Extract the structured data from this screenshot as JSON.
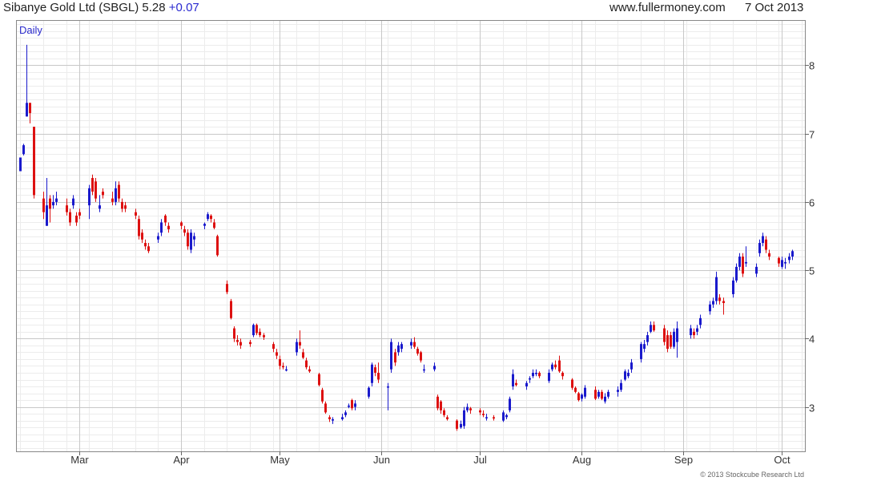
{
  "header": {
    "title": "Sibanye Gold Ltd (SBGL) 5.28",
    "change": "+0.07",
    "website": "www.fullermoney.com",
    "date": "7 Oct 2013"
  },
  "copyright": "© 2013 Stockcube Research Ltd",
  "colors": {
    "up": "#1a1acc",
    "down": "#dd1111",
    "grid_major": "#c8c8c8",
    "grid_minor": "#ececec"
  },
  "chart_data": {
    "type": "candlestick",
    "period_label": "Daily",
    "y_ticks": [
      3,
      4,
      5,
      6,
      7,
      8
    ],
    "y_range": [
      2.35,
      8.65
    ],
    "x_labels": [
      "Mar",
      "Apr",
      "May",
      "Jun",
      "Jul",
      "Aug",
      "Sep",
      "Oct"
    ],
    "x_label_dates": [
      "2013-03-01",
      "2013-04-01",
      "2013-05-01",
      "2013-06-01",
      "2013-07-01",
      "2013-08-01",
      "2013-09-01",
      "2013-10-01"
    ],
    "date_range": [
      "2013-02-10",
      "2013-10-08"
    ],
    "candles": [
      [
        "2013-02-11",
        6.45,
        6.65,
        6.45,
        6.65
      ],
      [
        "2013-02-12",
        6.7,
        6.85,
        6.68,
        6.83
      ],
      [
        "2013-02-13",
        7.25,
        8.3,
        7.25,
        7.45
      ],
      [
        "2013-02-14",
        7.45,
        7.45,
        7.15,
        7.3
      ],
      [
        "2013-02-15",
        7.1,
        7.1,
        6.05,
        6.1
      ],
      [
        "2013-02-18",
        6.05,
        6.15,
        5.75,
        5.85
      ],
      [
        "2013-02-19",
        5.65,
        6.35,
        5.65,
        5.95
      ],
      [
        "2013-02-20",
        6.05,
        6.1,
        5.7,
        5.9
      ],
      [
        "2013-02-21",
        5.95,
        6.1,
        5.9,
        6.0
      ],
      [
        "2013-02-22",
        6.0,
        6.15,
        5.95,
        6.05
      ],
      [
        "2013-02-25",
        5.95,
        6.05,
        5.8,
        5.85
      ],
      [
        "2013-02-26",
        5.85,
        5.9,
        5.65,
        5.7
      ],
      [
        "2013-02-27",
        5.95,
        6.1,
        5.9,
        6.05
      ],
      [
        "2013-02-28",
        5.8,
        5.85,
        5.65,
        5.7
      ],
      [
        "2013-03-01",
        5.85,
        5.9,
        5.75,
        5.8
      ],
      [
        "2013-03-04",
        5.95,
        6.25,
        5.75,
        6.2
      ],
      [
        "2013-03-05",
        6.35,
        6.4,
        6.1,
        6.15
      ],
      [
        "2013-03-06",
        6.3,
        6.35,
        6.0,
        6.05
      ],
      [
        "2013-03-07",
        5.9,
        6.1,
        5.85,
        5.95
      ],
      [
        "2013-03-08",
        6.15,
        6.2,
        6.05,
        6.1
      ],
      [
        "2013-03-11",
        6.05,
        6.15,
        5.95,
        6.0
      ],
      [
        "2013-03-12",
        6.0,
        6.3,
        5.95,
        6.2
      ],
      [
        "2013-03-13",
        6.25,
        6.3,
        6.0,
        6.05
      ],
      [
        "2013-03-14",
        6.0,
        6.05,
        5.85,
        5.9
      ],
      [
        "2013-03-15",
        5.95,
        6.0,
        5.85,
        5.9
      ],
      [
        "2013-03-18",
        5.85,
        5.9,
        5.75,
        5.8
      ],
      [
        "2013-03-19",
        5.75,
        5.8,
        5.45,
        5.5
      ],
      [
        "2013-03-20",
        5.55,
        5.6,
        5.4,
        5.45
      ],
      [
        "2013-03-21",
        5.4,
        5.45,
        5.3,
        5.35
      ],
      [
        "2013-03-22",
        5.35,
        5.4,
        5.25,
        5.28
      ],
      [
        "2013-03-25",
        5.45,
        5.55,
        5.4,
        5.5
      ],
      [
        "2013-03-26",
        5.55,
        5.75,
        5.5,
        5.7
      ],
      [
        "2013-03-27",
        5.8,
        5.82,
        5.65,
        5.7
      ],
      [
        "2013-03-28",
        5.65,
        5.7,
        5.55,
        5.6
      ],
      [
        "2013-04-01",
        5.7,
        5.72,
        5.6,
        5.65
      ],
      [
        "2013-04-02",
        5.6,
        5.65,
        5.5,
        5.55
      ],
      [
        "2013-04-03",
        5.55,
        5.6,
        5.3,
        5.35
      ],
      [
        "2013-04-04",
        5.3,
        5.6,
        5.25,
        5.55
      ],
      [
        "2013-04-05",
        5.45,
        5.55,
        5.35,
        5.5
      ],
      [
        "2013-04-08",
        5.65,
        5.7,
        5.6,
        5.68
      ],
      [
        "2013-04-09",
        5.75,
        5.85,
        5.72,
        5.82
      ],
      [
        "2013-04-10",
        5.8,
        5.82,
        5.7,
        5.75
      ],
      [
        "2013-04-11",
        5.7,
        5.75,
        5.6,
        5.62
      ],
      [
        "2013-04-12",
        5.5,
        5.52,
        5.2,
        5.22
      ],
      [
        "2013-04-15",
        4.8,
        4.85,
        4.65,
        4.68
      ],
      [
        "2013-04-16",
        4.55,
        4.58,
        4.28,
        4.3
      ],
      [
        "2013-04-17",
        4.15,
        4.18,
        3.95,
        4.0
      ],
      [
        "2013-04-18",
        3.98,
        4.05,
        3.9,
        3.95
      ],
      [
        "2013-04-19",
        3.95,
        4.0,
        3.85,
        3.9
      ],
      [
        "2013-04-22",
        3.95,
        3.98,
        3.88,
        3.92
      ],
      [
        "2013-04-23",
        4.05,
        4.22,
        4.02,
        4.2
      ],
      [
        "2013-04-24",
        4.2,
        4.22,
        4.05,
        4.08
      ],
      [
        "2013-04-25",
        4.1,
        4.15,
        4.02,
        4.05
      ],
      [
        "2013-04-26",
        4.05,
        4.08,
        3.98,
        4.02
      ],
      [
        "2013-04-29",
        3.92,
        3.95,
        3.8,
        3.85
      ],
      [
        "2013-04-30",
        3.8,
        3.85,
        3.7,
        3.75
      ],
      [
        "2013-05-01",
        3.7,
        3.75,
        3.55,
        3.6
      ],
      [
        "2013-05-02",
        3.6,
        3.65,
        3.55,
        3.58
      ],
      [
        "2013-05-03",
        3.55,
        3.6,
        3.52,
        3.55
      ],
      [
        "2013-05-06",
        3.8,
        4.0,
        3.75,
        3.95
      ],
      [
        "2013-05-07",
        3.95,
        4.12,
        3.85,
        3.9
      ],
      [
        "2013-05-08",
        3.8,
        3.85,
        3.7,
        3.72
      ],
      [
        "2013-05-09",
        3.68,
        3.72,
        3.55,
        3.58
      ],
      [
        "2013-05-10",
        3.55,
        3.6,
        3.5,
        3.52
      ],
      [
        "2013-05-13",
        3.48,
        3.5,
        3.3,
        3.32
      ],
      [
        "2013-05-14",
        3.25,
        3.28,
        3.05,
        3.08
      ],
      [
        "2013-05-15",
        3.05,
        3.08,
        2.9,
        2.92
      ],
      [
        "2013-05-16",
        2.85,
        2.88,
        2.78,
        2.82
      ],
      [
        "2013-05-17",
        2.8,
        2.85,
        2.75,
        2.82
      ],
      [
        "2013-05-20",
        2.82,
        2.9,
        2.8,
        2.85
      ],
      [
        "2013-05-21",
        2.88,
        2.95,
        2.85,
        2.92
      ],
      [
        "2013-05-22",
        3.0,
        3.05,
        2.98,
        3.02
      ],
      [
        "2013-05-23",
        3.1,
        3.12,
        2.95,
        2.98
      ],
      [
        "2013-05-24",
        3.0,
        3.1,
        2.95,
        3.05
      ],
      [
        "2013-05-28",
        3.15,
        3.3,
        3.12,
        3.28
      ],
      [
        "2013-05-29",
        3.35,
        3.65,
        3.3,
        3.62
      ],
      [
        "2013-05-30",
        3.58,
        3.62,
        3.45,
        3.5
      ],
      [
        "2013-05-31",
        3.5,
        3.65,
        3.35,
        3.4
      ],
      [
        "2013-06-03",
        3.3,
        3.35,
        2.95,
        3.3
      ],
      [
        "2013-06-04",
        3.55,
        4.0,
        3.5,
        3.95
      ],
      [
        "2013-06-05",
        3.8,
        3.85,
        3.6,
        3.65
      ],
      [
        "2013-06-06",
        3.8,
        3.95,
        3.75,
        3.9
      ],
      [
        "2013-06-07",
        3.85,
        3.95,
        3.8,
        3.92
      ],
      [
        "2013-06-10",
        3.9,
        4.0,
        3.85,
        3.95
      ],
      [
        "2013-06-11",
        3.95,
        4.02,
        3.85,
        3.88
      ],
      [
        "2013-06-12",
        3.85,
        3.88,
        3.75,
        3.78
      ],
      [
        "2013-06-13",
        3.8,
        3.82,
        3.65,
        3.68
      ],
      [
        "2013-06-14",
        3.55,
        3.62,
        3.5,
        3.55
      ],
      [
        "2013-06-17",
        3.55,
        3.65,
        3.52,
        3.6
      ],
      [
        "2013-06-18",
        3.15,
        3.18,
        2.95,
        2.98
      ],
      [
        "2013-06-19",
        3.08,
        3.1,
        2.9,
        2.95
      ],
      [
        "2013-06-20",
        2.95,
        2.98,
        2.85,
        2.88
      ],
      [
        "2013-06-21",
        2.85,
        2.88,
        2.8,
        2.82
      ],
      [
        "2013-06-24",
        2.8,
        2.82,
        2.65,
        2.68
      ],
      [
        "2013-06-25",
        2.7,
        2.8,
        2.68,
        2.75
      ],
      [
        "2013-06-26",
        2.72,
        3.0,
        2.68,
        2.95
      ],
      [
        "2013-06-27",
        2.95,
        3.05,
        2.92,
        3.0
      ],
      [
        "2013-06-28",
        2.98,
        3.0,
        2.9,
        2.95
      ],
      [
        "2013-07-01",
        2.95,
        2.98,
        2.88,
        2.92
      ],
      [
        "2013-07-02",
        2.9,
        2.95,
        2.85,
        2.88
      ],
      [
        "2013-07-03",
        2.85,
        2.9,
        2.8,
        2.85
      ],
      [
        "2013-07-05",
        2.85,
        2.88,
        2.8,
        2.83
      ],
      [
        "2013-07-08",
        2.8,
        2.95,
        2.78,
        2.92
      ],
      [
        "2013-07-09",
        2.85,
        2.9,
        2.82,
        2.88
      ],
      [
        "2013-07-10",
        2.95,
        3.15,
        2.92,
        3.12
      ],
      [
        "2013-07-11",
        3.3,
        3.55,
        3.25,
        3.48
      ],
      [
        "2013-07-12",
        3.35,
        3.4,
        3.3,
        3.32
      ],
      [
        "2013-07-15",
        3.3,
        3.38,
        3.25,
        3.35
      ],
      [
        "2013-07-16",
        3.4,
        3.45,
        3.35,
        3.42
      ],
      [
        "2013-07-17",
        3.45,
        3.55,
        3.42,
        3.5
      ],
      [
        "2013-07-18",
        3.48,
        3.55,
        3.45,
        3.5
      ],
      [
        "2013-07-19",
        3.5,
        3.52,
        3.42,
        3.45
      ],
      [
        "2013-07-22",
        3.38,
        3.55,
        3.35,
        3.5
      ],
      [
        "2013-07-23",
        3.55,
        3.65,
        3.52,
        3.62
      ],
      [
        "2013-07-24",
        3.62,
        3.68,
        3.55,
        3.58
      ],
      [
        "2013-07-25",
        3.68,
        3.75,
        3.5,
        3.52
      ],
      [
        "2013-07-26",
        3.5,
        3.52,
        3.4,
        3.45
      ],
      [
        "2013-07-29",
        3.4,
        3.42,
        3.25,
        3.28
      ],
      [
        "2013-07-30",
        3.28,
        3.3,
        3.2,
        3.22
      ],
      [
        "2013-07-31",
        3.2,
        3.22,
        3.08,
        3.1
      ],
      [
        "2013-08-01",
        3.12,
        3.2,
        3.08,
        3.18
      ],
      [
        "2013-08-02",
        3.15,
        3.32,
        3.12,
        3.28
      ],
      [
        "2013-08-05",
        3.25,
        3.3,
        3.1,
        3.12
      ],
      [
        "2013-08-06",
        3.15,
        3.25,
        3.12,
        3.22
      ],
      [
        "2013-08-07",
        3.22,
        3.25,
        3.1,
        3.12
      ],
      [
        "2013-08-08",
        3.08,
        3.2,
        3.05,
        3.15
      ],
      [
        "2013-08-09",
        3.15,
        3.25,
        3.12,
        3.22
      ],
      [
        "2013-08-12",
        3.22,
        3.3,
        3.15,
        3.25
      ],
      [
        "2013-08-13",
        3.25,
        3.4,
        3.22,
        3.35
      ],
      [
        "2013-08-14",
        3.4,
        3.55,
        3.38,
        3.52
      ],
      [
        "2013-08-15",
        3.45,
        3.55,
        3.42,
        3.5
      ],
      [
        "2013-08-16",
        3.55,
        3.7,
        3.5,
        3.65
      ],
      [
        "2013-08-19",
        3.7,
        3.95,
        3.65,
        3.92
      ],
      [
        "2013-08-20",
        3.85,
        3.98,
        3.8,
        3.92
      ],
      [
        "2013-08-21",
        3.95,
        4.1,
        3.9,
        4.05
      ],
      [
        "2013-08-22",
        4.1,
        4.25,
        4.08,
        4.2
      ],
      [
        "2013-08-23",
        4.2,
        4.25,
        4.1,
        4.12
      ],
      [
        "2013-08-26",
        4.15,
        4.2,
        3.9,
        3.95
      ],
      [
        "2013-08-27",
        4.05,
        4.12,
        3.8,
        3.85
      ],
      [
        "2013-08-28",
        4.05,
        4.1,
        3.85,
        3.88
      ],
      [
        "2013-08-29",
        3.88,
        4.15,
        3.85,
        4.1
      ],
      [
        "2013-08-30",
        3.95,
        4.25,
        3.72,
        4.15
      ],
      [
        "2013-09-03",
        4.05,
        4.2,
        4.0,
        4.15
      ],
      [
        "2013-09-04",
        4.1,
        4.15,
        4.0,
        4.05
      ],
      [
        "2013-09-05",
        4.1,
        4.2,
        4.05,
        4.15
      ],
      [
        "2013-09-06",
        4.2,
        4.35,
        4.15,
        4.3
      ],
      [
        "2013-09-09",
        4.4,
        4.55,
        4.35,
        4.5
      ],
      [
        "2013-09-10",
        4.5,
        4.6,
        4.45,
        4.55
      ],
      [
        "2013-09-11",
        4.55,
        4.98,
        4.5,
        4.9
      ],
      [
        "2013-09-12",
        4.6,
        4.65,
        4.5,
        4.55
      ],
      [
        "2013-09-13",
        4.55,
        4.6,
        4.35,
        4.52
      ],
      [
        "2013-09-16",
        4.65,
        4.9,
        4.6,
        4.85
      ],
      [
        "2013-09-17",
        4.85,
        5.1,
        4.82,
        5.05
      ],
      [
        "2013-09-18",
        5.05,
        5.25,
        5.0,
        5.2
      ],
      [
        "2013-09-19",
        5.2,
        5.25,
        4.9,
        4.95
      ],
      [
        "2013-09-20",
        5.1,
        5.35,
        5.05,
        5.12
      ],
      [
        "2013-09-23",
        4.95,
        5.1,
        4.9,
        5.05
      ],
      [
        "2013-09-24",
        5.25,
        5.45,
        5.2,
        5.4
      ],
      [
        "2013-09-25",
        5.4,
        5.55,
        5.35,
        5.5
      ],
      [
        "2013-09-26",
        5.45,
        5.5,
        5.25,
        5.3
      ],
      [
        "2013-09-27",
        5.25,
        5.3,
        5.15,
        5.2
      ],
      [
        "2013-09-30",
        5.18,
        5.2,
        5.05,
        5.1
      ],
      [
        "2013-10-01",
        5.05,
        5.2,
        5.02,
        5.15
      ],
      [
        "2013-10-02",
        5.1,
        5.18,
        5.02,
        5.12
      ],
      [
        "2013-10-03",
        5.15,
        5.25,
        5.1,
        5.2
      ],
      [
        "2013-10-04",
        5.2,
        5.3,
        5.15,
        5.28
      ]
    ]
  }
}
